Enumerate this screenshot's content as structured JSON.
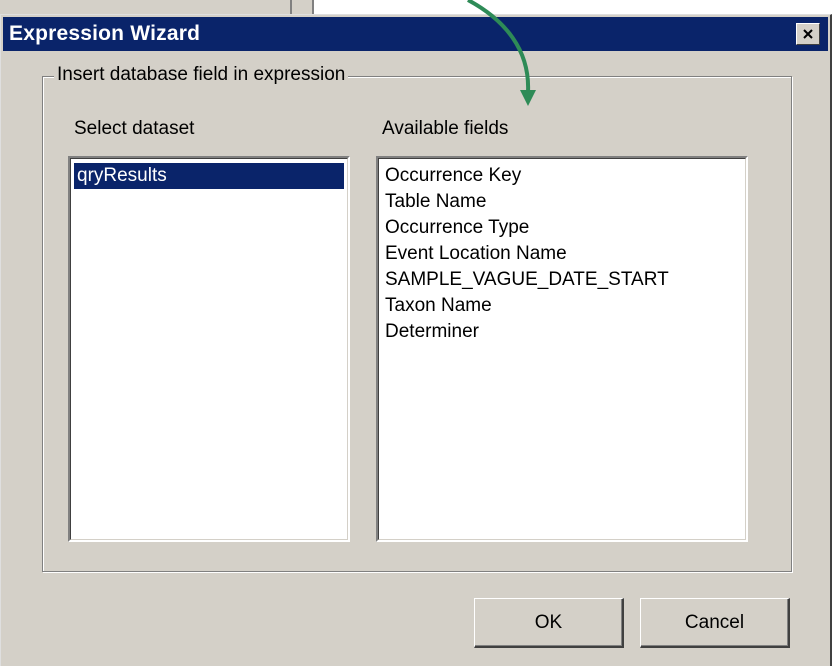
{
  "dialog": {
    "title": "Expression Wizard",
    "close_icon": "close-icon",
    "group_label": "Insert database field in expression",
    "dataset_label": "Select dataset",
    "fields_label": "Available fields",
    "datasets": [
      {
        "label": "qryResults",
        "selected": true
      }
    ],
    "fields": [
      {
        "label": "Occurrence Key"
      },
      {
        "label": "Table Name"
      },
      {
        "label": "Occurrence Type"
      },
      {
        "label": "Event Location Name"
      },
      {
        "label": "SAMPLE_VAGUE_DATE_START"
      },
      {
        "label": "Taxon Name"
      },
      {
        "label": "Determiner"
      }
    ],
    "ok_label": "OK",
    "cancel_label": "Cancel"
  },
  "annotation": {
    "arrow_color": "#2e8b57"
  },
  "colors": {
    "titlebar": "#0a246a",
    "face": "#d4d0c8",
    "selection": "#0a246a"
  }
}
